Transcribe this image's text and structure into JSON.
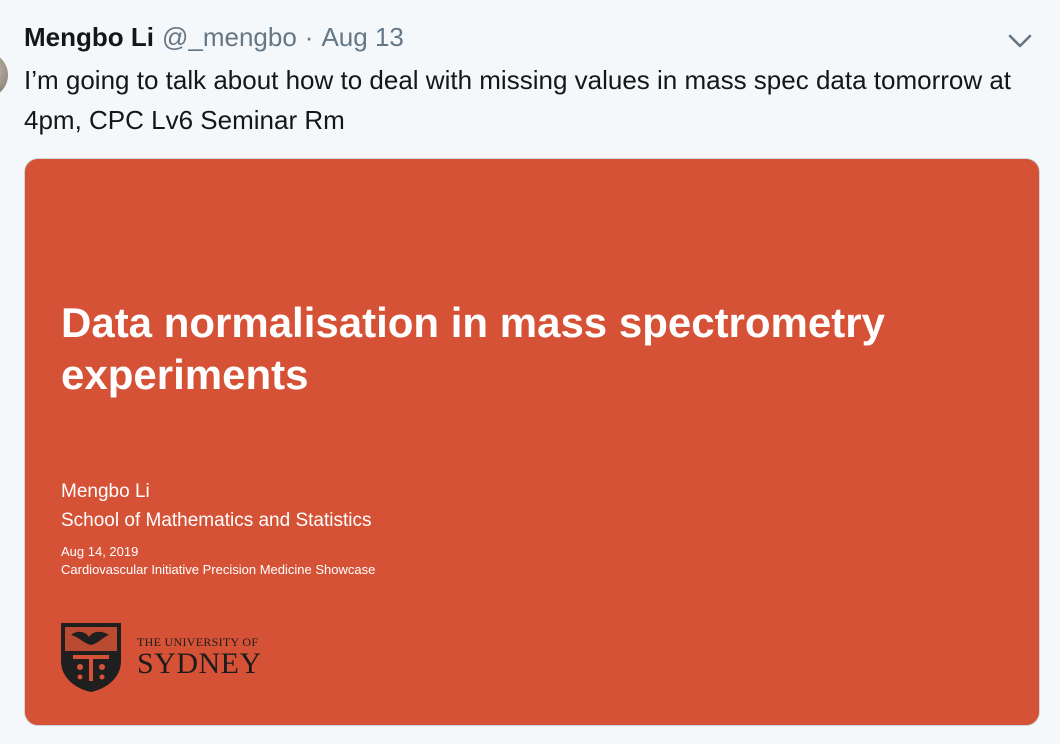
{
  "tweet": {
    "author_name": "Mengbo Li",
    "handle": "@_mengbo",
    "separator": "·",
    "date": "Aug 13",
    "text": "I’m going to talk about how to deal with missing values in mass spec data tomorrow at 4pm, CPC Lv6 Seminar Rm",
    "menu_icon": "chevron-down-icon"
  },
  "card": {
    "background_color": "#d65236",
    "slide_title": "Data normalisation in mass spectrometry experiments",
    "presenter_name": "Mengbo Li",
    "presenter_affiliation": "School of Mathematics and Statistics",
    "event_date": "Aug 14, 2019",
    "event_name": "Cardiovascular Initiative Precision Medicine Showcase",
    "logo": {
      "line1": "THE UNIVERSITY OF",
      "line2": "SYDNEY"
    }
  }
}
